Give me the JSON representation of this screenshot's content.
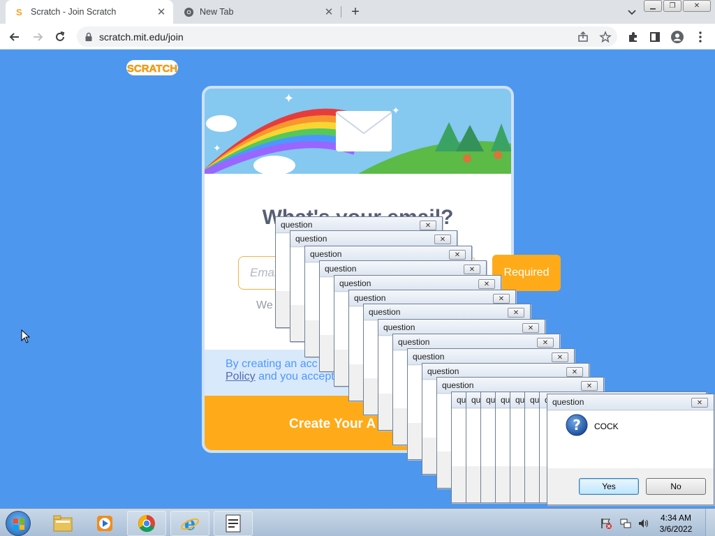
{
  "browser": {
    "tabs": [
      {
        "title": "Scratch - Join Scratch",
        "favicon": "scratch-favicon",
        "active": true
      },
      {
        "title": "New Tab",
        "favicon": "chrome-favicon",
        "active": false
      }
    ],
    "url": "scratch.mit.edu/join"
  },
  "page": {
    "logo_text": "SCRATCH",
    "heading": "What's your email?",
    "email_placeholder": "Email",
    "helper_text": "We",
    "terms_line1": "By creating an acc",
    "terms_link": "Policy",
    "terms_line2": " and you accept",
    "create_button": "Create Your A",
    "required_tip": "Required"
  },
  "dialogs": {
    "title": "question",
    "stack_count": 12,
    "front": {
      "title": "question",
      "message": "COCK",
      "yes_label": "Yes",
      "no_label": "No",
      "icon": "question-icon"
    },
    "rear_title_fragment": "qu"
  },
  "taskbar": {
    "time": "4:34 AM",
    "date": "3/6/2022"
  },
  "colors": {
    "page_bg": "#4d97ef",
    "scratch_orange": "#ffab19",
    "scratch_blue": "#4c97ff"
  }
}
